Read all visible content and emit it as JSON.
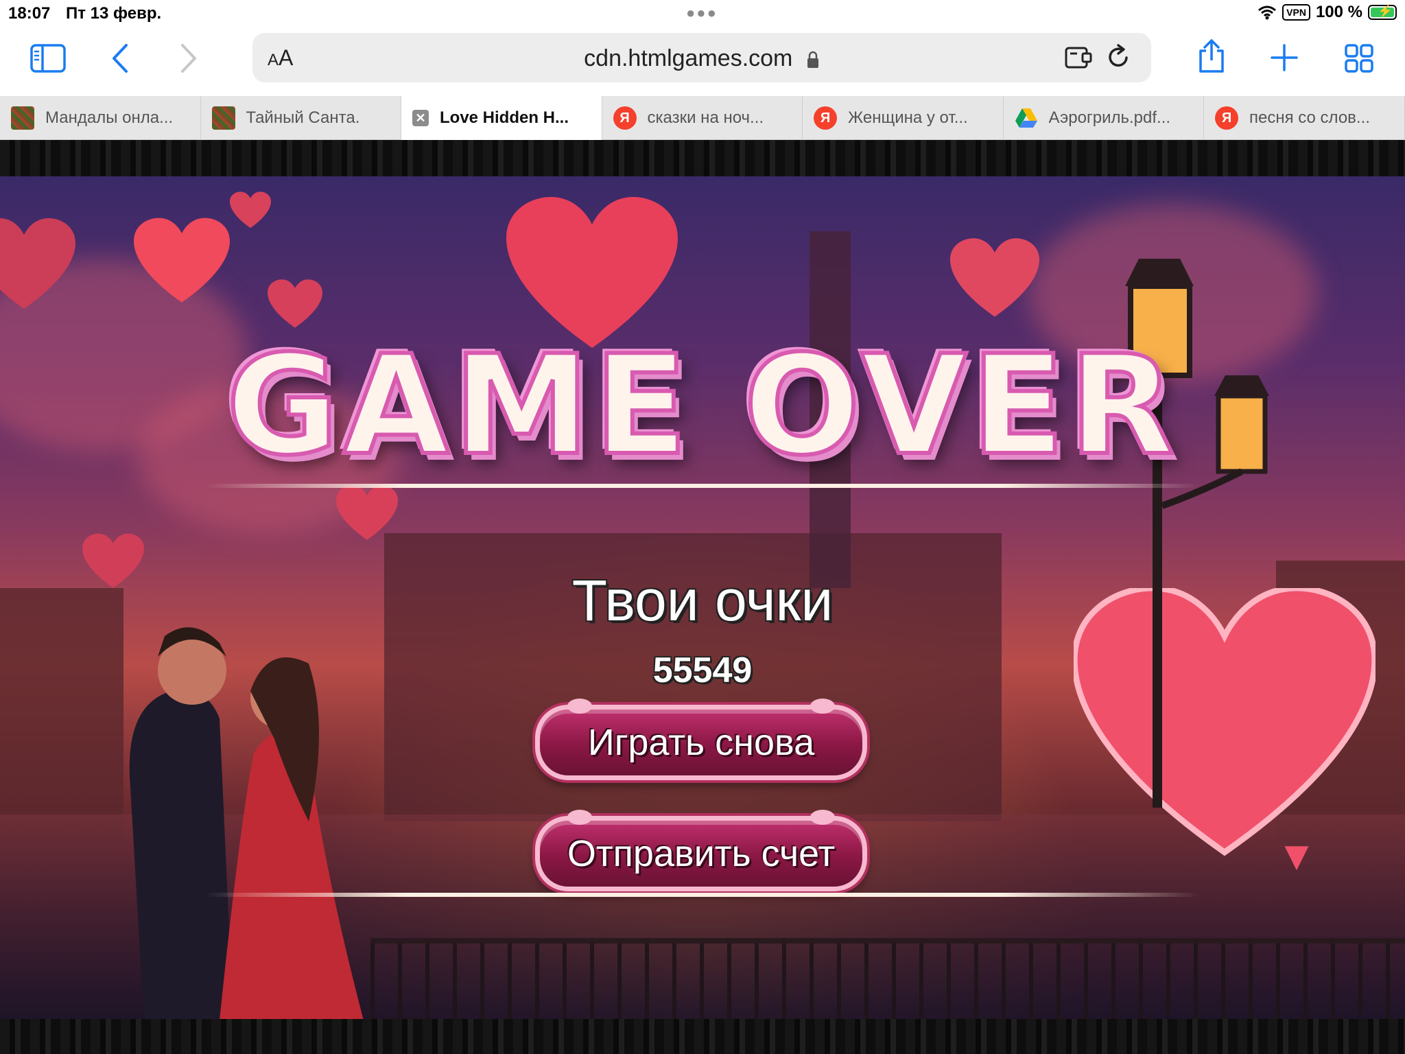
{
  "status_bar": {
    "time": "18:07",
    "date": "Пт 13 февр.",
    "vpn": "VPN",
    "battery": "100 %"
  },
  "toolbar": {
    "text_size_label_small": "A",
    "text_size_label_large": "A",
    "url": "cdn.htmlgames.com"
  },
  "tabs": [
    {
      "label": "Мандалы онла...",
      "favicon": "mandala"
    },
    {
      "label": "Тайный Санта.",
      "favicon": "mandala"
    },
    {
      "label": "Love Hidden H...",
      "favicon": "close",
      "active": true
    },
    {
      "label": "сказки на ноч...",
      "favicon": "yandex"
    },
    {
      "label": "Женщина у от...",
      "favicon": "yandex"
    },
    {
      "label": "Аэрогриль.pdf...",
      "favicon": "gdrive"
    },
    {
      "label": "песня со слов...",
      "favicon": "yandex"
    }
  ],
  "favicon_letters": {
    "yandex": "Я",
    "close": "✕"
  },
  "game": {
    "title": "GAME OVER",
    "score_label": "Твои очки",
    "score_value": "55549",
    "play_again": "Играть снова",
    "submit_score": "Отправить счет"
  },
  "colors": {
    "accent": "#1a7cf0",
    "button": "#8a1744",
    "title_stroke": "#d85bb0"
  }
}
